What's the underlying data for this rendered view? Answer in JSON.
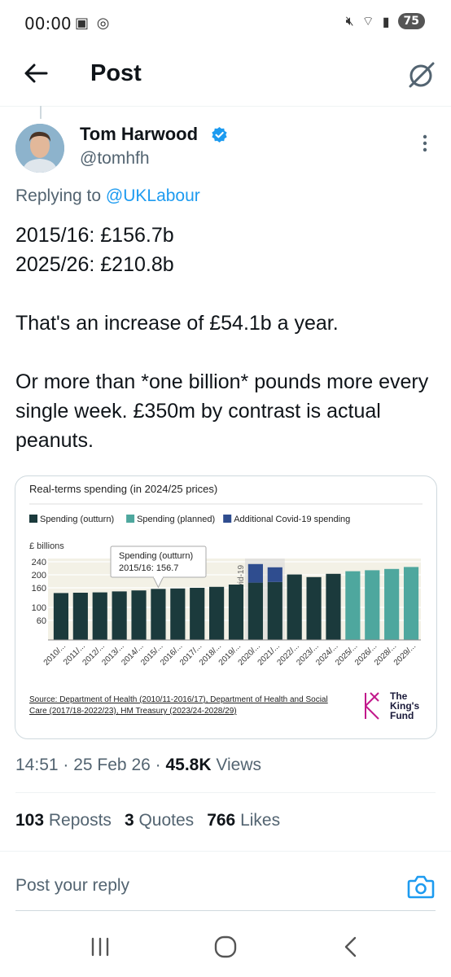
{
  "status": {
    "time": "00:00",
    "battery": "75"
  },
  "header": {
    "title": "Post"
  },
  "post": {
    "author_name": "Tom Harwood",
    "author_handle": "@tomhfh",
    "replying_prefix": "Replying to ",
    "replying_to": "@UKLabour",
    "lines": [
      "2015/16: £156.7b",
      "2025/26: £210.8b",
      "",
      "That's an increase of £54.1b a year.",
      "",
      "Or more than *one billion* pounds more every single week. £350m by contrast is actual peanuts."
    ]
  },
  "chart_data": {
    "type": "bar",
    "title": "Real-terms spending (in 2024/25 prices)",
    "ylabel": "£ billions",
    "yticks": [
      60,
      100,
      160,
      200,
      240
    ],
    "ylim": [
      0,
      250
    ],
    "legend_placement": "top-left",
    "colors": {
      "outturn": "#1b3a3c",
      "planned": "#4ea79e",
      "covid": "#2f4d8f"
    },
    "categories": [
      "2010/...",
      "2011/...",
      "2012/...",
      "2013/...",
      "2014/...",
      "2015/...",
      "2016/...",
      "2017/...",
      "2018/...",
      "2019/...",
      "2020/...",
      "2021/...",
      "2022/...",
      "2023/...",
      "2024/...",
      "2025/...",
      "2026/...",
      "2028/...",
      "2029/..."
    ],
    "series": [
      {
        "name": "Spending (outturn)",
        "values": [
          144,
          145,
          146,
          149,
          152,
          156.7,
          158,
          160,
          163,
          170,
          176,
          178,
          201,
          193,
          203,
          null,
          null,
          null,
          null
        ]
      },
      {
        "name": "Spending (planned)",
        "values": [
          null,
          null,
          null,
          null,
          null,
          null,
          null,
          null,
          null,
          null,
          null,
          null,
          null,
          null,
          null,
          211,
          214,
          218,
          224
        ]
      },
      {
        "name": "Additional Covid-19 spending",
        "values": [
          null,
          null,
          null,
          null,
          null,
          null,
          null,
          null,
          null,
          null,
          57,
          45,
          null,
          null,
          null,
          null,
          null,
          null,
          null
        ]
      }
    ],
    "annotations": [
      {
        "text": "Covid-19"
      }
    ],
    "tooltip": {
      "title": "Spending (outturn)",
      "value": "2015/16: 156.7"
    },
    "source_prefix": "Source: ",
    "source_text": "Department of Health (2010/11-2016/17), Department of Health and Social Care (2017/18-2022/23), HM Treasury (2023/24-2028/29)",
    "logo_text": [
      "The",
      "King's",
      "Fund"
    ]
  },
  "meta": {
    "time": "14:51",
    "date": "25 Feb 26",
    "views_count": "45.8K",
    "views_label": "Views"
  },
  "stats": {
    "reposts_count": "103",
    "reposts_label": "Reposts",
    "quotes_count": "3",
    "quotes_label": "Quotes",
    "likes_count": "766",
    "likes_label": "Likes"
  },
  "reply": {
    "placeholder": "Post your reply"
  }
}
